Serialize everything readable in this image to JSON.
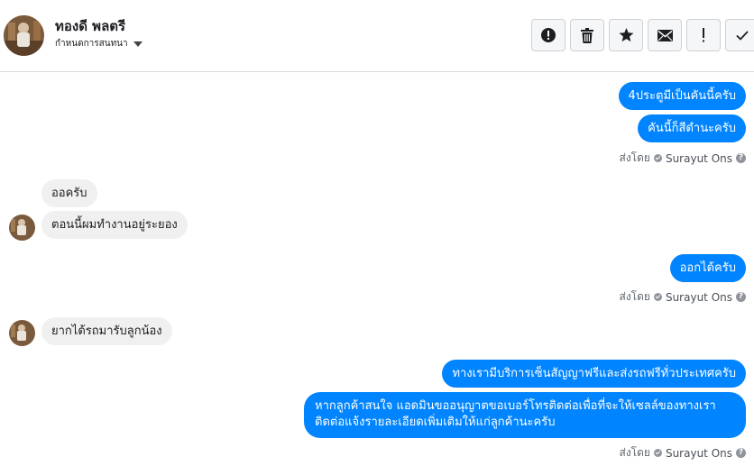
{
  "contact": {
    "name": "ทองดี พลตรี",
    "status_menu": "กำหนดการสนทนา"
  },
  "toolbar": [
    {
      "id": "report",
      "icon": "exclamation-circle-icon"
    },
    {
      "id": "delete",
      "icon": "trash-icon"
    },
    {
      "id": "star",
      "icon": "star-icon"
    },
    {
      "id": "mail",
      "icon": "envelope-icon"
    },
    {
      "id": "important",
      "icon": "exclamation-icon"
    },
    {
      "id": "done",
      "icon": "checkmark-icon"
    }
  ],
  "messages": [
    {
      "side": "out",
      "text": "4ประตูมีเป็นคันนี้ครับ"
    },
    {
      "side": "out",
      "text": "คันนี้ก็สีดำนะครับ"
    },
    {
      "side": "meta",
      "prefix": "ส่งโดย",
      "agent": "Surayut Ons"
    },
    {
      "side": "in",
      "text": "ออครับ"
    },
    {
      "side": "in",
      "text": "ตอนนี้ผมทำงานอยู่ระยอง"
    },
    {
      "side": "out",
      "text": "ออกได้ครับ"
    },
    {
      "side": "meta",
      "prefix": "ส่งโดย",
      "agent": "Surayut Ons"
    },
    {
      "side": "in",
      "text": "ยากได้รถมารับลูกน้อง"
    },
    {
      "side": "out",
      "text": "ทางเรามีบริการเซ็นสัญญาฟรีและส่งรถฟรีทั่วประเทศครับ"
    },
    {
      "side": "out",
      "text": "หากลูกค้าสนใจ แอดมินขออนุญาตขอเบอร์โทรติดต่อเพื่อที่จะให้เซลล์ของทางเราติดต่อแจ้งรายละเอียดเพิ่มเติมให้แก่ลูกค้านะครับ"
    },
    {
      "side": "meta",
      "prefix": "ส่งโดย",
      "agent": "Surayut Ons"
    }
  ]
}
